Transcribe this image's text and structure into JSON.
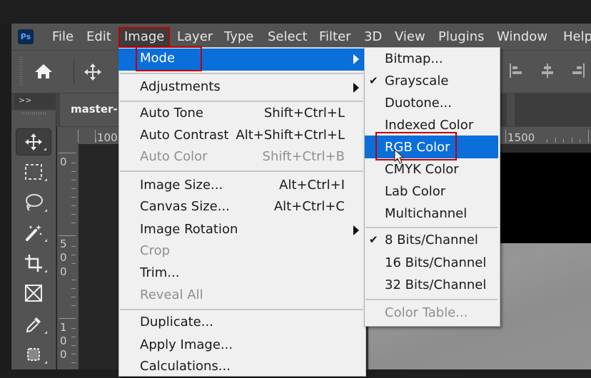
{
  "app": {
    "logo_text": "Ps",
    "document_tab": "master-"
  },
  "menubar": {
    "items": [
      {
        "label": "File"
      },
      {
        "label": "Edit"
      },
      {
        "label": "Image"
      },
      {
        "label": "Layer"
      },
      {
        "label": "Type"
      },
      {
        "label": "Select"
      },
      {
        "label": "Filter"
      },
      {
        "label": "3D"
      },
      {
        "label": "View"
      },
      {
        "label": "Plugins"
      },
      {
        "label": "Window"
      },
      {
        "label": "Help"
      }
    ],
    "active": "Image"
  },
  "options_bar": {
    "icons": [
      "home-icon",
      "move-icon",
      "align-left-icon",
      "align-center-icon",
      "align-right-icon"
    ]
  },
  "panel": {
    "collapse_label": ">>"
  },
  "toolbox": {
    "tools": [
      {
        "name": "move-tool",
        "active": true
      },
      {
        "name": "rectangular-marquee-tool",
        "active": false
      },
      {
        "name": "lasso-tool",
        "active": false
      },
      {
        "name": "magic-wand-tool",
        "active": false
      },
      {
        "name": "crop-tool",
        "active": false
      },
      {
        "name": "frame-tool",
        "active": false
      },
      {
        "name": "eyedropper-tool",
        "active": false
      },
      {
        "name": "object-selection-tool",
        "active": false
      }
    ]
  },
  "rulers": {
    "horizontal": [
      "100",
      "1500"
    ],
    "vertical": [
      "0",
      "5",
      "0",
      "0",
      "1",
      "0",
      "0"
    ]
  },
  "image_menu": {
    "items": [
      {
        "label": "Mode",
        "shortcut": "",
        "submenu": true,
        "highlighted": true,
        "disabled": false
      },
      {
        "label": "Adjustments",
        "shortcut": "",
        "submenu": true,
        "highlighted": false,
        "disabled": false
      },
      {
        "label": "Auto Tone",
        "shortcut": "Shift+Ctrl+L",
        "submenu": false,
        "disabled": false
      },
      {
        "label": "Auto Contrast",
        "shortcut": "Alt+Shift+Ctrl+L",
        "submenu": false,
        "disabled": false
      },
      {
        "label": "Auto Color",
        "shortcut": "Shift+Ctrl+B",
        "submenu": false,
        "disabled": true
      },
      {
        "label": "Image Size...",
        "shortcut": "Alt+Ctrl+I",
        "submenu": false,
        "disabled": false
      },
      {
        "label": "Canvas Size...",
        "shortcut": "Alt+Ctrl+C",
        "submenu": false,
        "disabled": false
      },
      {
        "label": "Image Rotation",
        "shortcut": "",
        "submenu": true,
        "disabled": false
      },
      {
        "label": "Crop",
        "shortcut": "",
        "submenu": false,
        "disabled": true
      },
      {
        "label": "Trim...",
        "shortcut": "",
        "submenu": false,
        "disabled": false
      },
      {
        "label": "Reveal All",
        "shortcut": "",
        "submenu": false,
        "disabled": true
      },
      {
        "label": "Duplicate...",
        "shortcut": "",
        "submenu": false,
        "disabled": false
      },
      {
        "label": "Apply Image...",
        "shortcut": "",
        "submenu": false,
        "disabled": false
      },
      {
        "label": "Calculations...",
        "shortcut": "",
        "submenu": false,
        "disabled": false
      }
    ]
  },
  "mode_submenu": {
    "items": [
      {
        "label": "Bitmap...",
        "checked": false,
        "highlighted": false,
        "disabled": false
      },
      {
        "label": "Grayscale",
        "checked": true,
        "highlighted": false,
        "disabled": false
      },
      {
        "label": "Duotone...",
        "checked": false,
        "highlighted": false,
        "disabled": false
      },
      {
        "label": "Indexed Color",
        "checked": false,
        "highlighted": false,
        "disabled": false
      },
      {
        "label": "RGB Color",
        "checked": false,
        "highlighted": true,
        "disabled": false
      },
      {
        "label": "CMYK Color",
        "checked": false,
        "highlighted": false,
        "disabled": false
      },
      {
        "label": "Lab Color",
        "checked": false,
        "highlighted": false,
        "disabled": false
      },
      {
        "label": "Multichannel",
        "checked": false,
        "highlighted": false,
        "disabled": false
      },
      {
        "label": "8 Bits/Channel",
        "checked": true,
        "highlighted": false,
        "disabled": false
      },
      {
        "label": "16 Bits/Channel",
        "checked": false,
        "highlighted": false,
        "disabled": false
      },
      {
        "label": "32 Bits/Channel",
        "checked": false,
        "highlighted": false,
        "disabled": false
      },
      {
        "label": "Color Table...",
        "checked": false,
        "highlighted": false,
        "disabled": true
      }
    ],
    "check_glyph": "✔"
  },
  "annotations": {
    "highlight_color": "#c00000",
    "targets": [
      "Image",
      "Mode",
      "RGB Color"
    ]
  },
  "colors": {
    "menu_highlight": "#0a6fdb",
    "menu_bg": "#f0f0f0",
    "chrome_bg": "#535353"
  }
}
